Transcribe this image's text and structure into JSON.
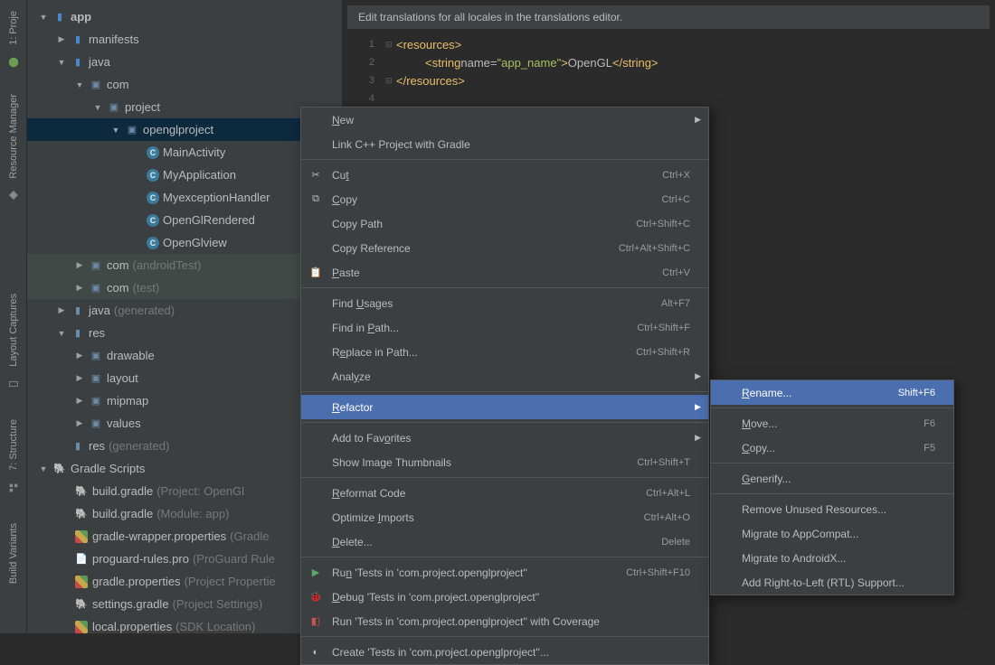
{
  "rail": {
    "project_tab": "1: Proje",
    "resource_manager": "Resource Manager",
    "layout_captures": "Layout Captures",
    "structure": "7: Structure",
    "build_variants": "Build Variants"
  },
  "tree": {
    "app": "app",
    "manifests": "manifests",
    "java": "java",
    "com": "com",
    "project": "project",
    "openglproject": "openglproject",
    "MainActivity": "MainActivity",
    "MyApplication": "MyApplication",
    "MyexceptionHandler": "MyexceptionHandler",
    "OpenGlRendered": "OpenGlRendered",
    "OpenGlview": "OpenGlview",
    "com_androidTest": "com",
    "com_androidTest_suffix": "(androidTest)",
    "com_test": "com",
    "com_test_suffix": "(test)",
    "java_generated": "java",
    "java_generated_suffix": "(generated)",
    "res": "res",
    "drawable": "drawable",
    "layout": "layout",
    "mipmap": "mipmap",
    "values": "values",
    "res_generated": "res",
    "res_generated_suffix": "(generated)",
    "gradle_scripts": "Gradle Scripts",
    "build_gradle1": "build.gradle",
    "build_gradle1_suffix": "(Project: OpenGl",
    "build_gradle2": "build.gradle",
    "build_gradle2_suffix": "(Module: app)",
    "gradle_wrapper": "gradle-wrapper.properties",
    "gradle_wrapper_suffix": "(Gradle",
    "proguard": "proguard-rules.pro",
    "proguard_suffix": "(ProGuard Rule",
    "gradle_properties": "gradle.properties",
    "gradle_properties_suffix": "(Project Propertie",
    "settings_gradle": "settings.gradle",
    "settings_gradle_suffix": "(Project Settings)",
    "local_properties": "local.properties",
    "local_properties_suffix": "(SDK Location)"
  },
  "editor": {
    "hint": "Edit translations for all locales in the translations editor.",
    "line1_open": "<resources>",
    "line2_open": "<string",
    "line2_attr": " name=",
    "line2_val": "\"app_name\"",
    "line2_close": ">",
    "line2_text": "OpenGL",
    "line2_endtag": "</string>",
    "line3": "</resources>",
    "ln1": "1",
    "ln2": "2",
    "ln3": "3",
    "ln4": "4"
  },
  "menu1": [
    {
      "label": "New",
      "sub": true,
      "u": 0
    },
    {
      "label": "Link C++ Project with Gradle"
    },
    {
      "sep": true
    },
    {
      "label": "Cut",
      "shortcut": "Ctrl+X",
      "icon": "cut",
      "u": 2
    },
    {
      "label": "Copy",
      "shortcut": "Ctrl+C",
      "icon": "copy",
      "u": 0
    },
    {
      "label": "Copy Path",
      "shortcut": "Ctrl+Shift+C"
    },
    {
      "label": "Copy Reference",
      "shortcut": "Ctrl+Alt+Shift+C"
    },
    {
      "label": "Paste",
      "shortcut": "Ctrl+V",
      "icon": "paste",
      "u": 0
    },
    {
      "sep": true
    },
    {
      "label": "Find Usages",
      "shortcut": "Alt+F7",
      "u": 5
    },
    {
      "label": "Find in Path...",
      "shortcut": "Ctrl+Shift+F",
      "u": 8
    },
    {
      "label": "Replace in Path...",
      "shortcut": "Ctrl+Shift+R",
      "u": 1
    },
    {
      "label": "Analyze",
      "sub": true,
      "u": 4
    },
    {
      "sep": true
    },
    {
      "label": "Refactor",
      "sub": true,
      "hl": true,
      "u": 0
    },
    {
      "sep": true
    },
    {
      "label": "Add to Favorites",
      "sub": true,
      "u": 10
    },
    {
      "label": "Show Image Thumbnails",
      "shortcut": "Ctrl+Shift+T"
    },
    {
      "sep": true
    },
    {
      "label": "Reformat Code",
      "shortcut": "Ctrl+Alt+L",
      "u": 0
    },
    {
      "label": "Optimize Imports",
      "shortcut": "Ctrl+Alt+O",
      "u": 9
    },
    {
      "label": "Delete...",
      "shortcut": "Delete",
      "u": 0
    },
    {
      "sep": true
    },
    {
      "label": "Run 'Tests in 'com.project.openglproject''",
      "shortcut": "Ctrl+Shift+F10",
      "icon": "play",
      "u": 2
    },
    {
      "label": "Debug 'Tests in 'com.project.openglproject''",
      "icon": "bug",
      "u": 0
    },
    {
      "label": "Run 'Tests in 'com.project.openglproject'' with Coverage",
      "icon": "shield"
    },
    {
      "sep": true
    },
    {
      "label": "Create 'Tests in 'com.project.openglproject''...",
      "icon": "create"
    }
  ],
  "menu2": [
    {
      "label": "Rename...",
      "shortcut": "Shift+F6",
      "hl": true,
      "u": 0
    },
    {
      "sep": true
    },
    {
      "label": "Move...",
      "shortcut": "F6",
      "u": 0
    },
    {
      "label": "Copy...",
      "shortcut": "F5",
      "u": 0
    },
    {
      "sep": true
    },
    {
      "label": "Generify...",
      "u": 0
    },
    {
      "sep": true
    },
    {
      "label": "Remove Unused Resources..."
    },
    {
      "label": "Migrate to AppCompat..."
    },
    {
      "label": "Migrate to AndroidX..."
    },
    {
      "label": "Add Right-to-Left (RTL) Support..."
    }
  ]
}
